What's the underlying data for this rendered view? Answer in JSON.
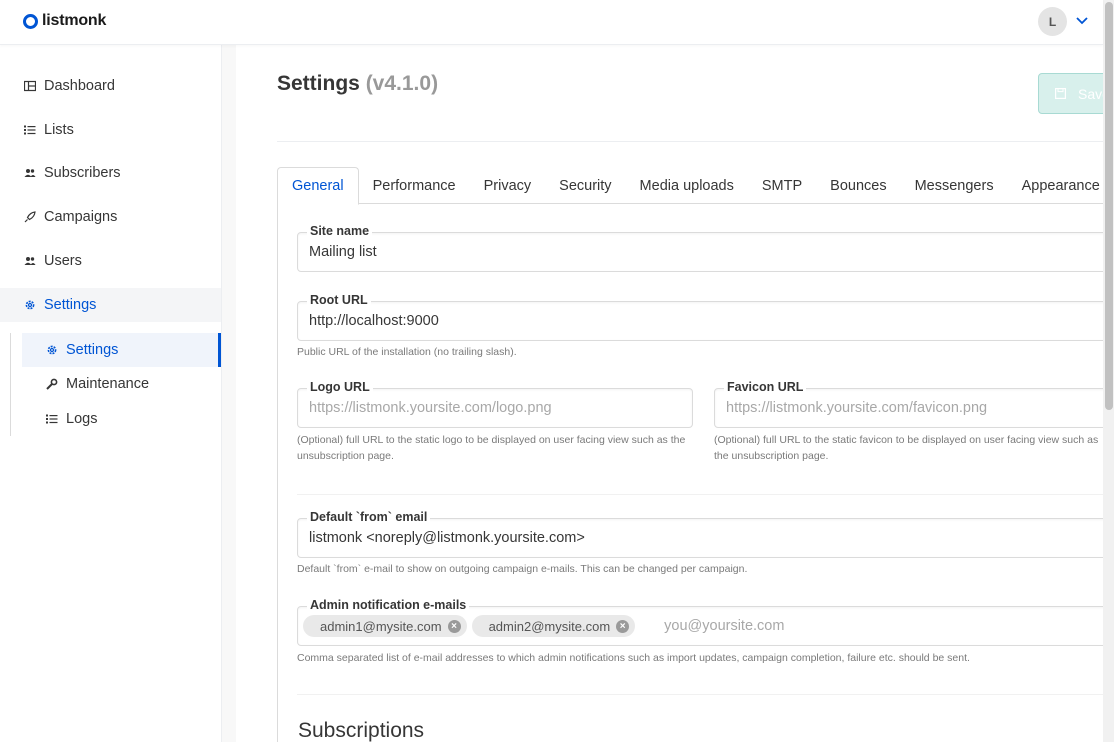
{
  "app": {
    "logo_text": "listmonk",
    "brand_color": "#0055d4"
  },
  "header": {
    "avatar_initial": "L"
  },
  "sidebar": {
    "items": [
      {
        "label": "Dashboard",
        "icon": "dashboard-icon"
      },
      {
        "label": "Lists",
        "icon": "list-icon"
      },
      {
        "label": "Subscribers",
        "icon": "users-icon"
      },
      {
        "label": "Campaigns",
        "icon": "rocket-icon"
      },
      {
        "label": "Users",
        "icon": "users-icon"
      },
      {
        "label": "Settings",
        "icon": "gear-icon"
      }
    ],
    "sub_items": [
      {
        "label": "Settings",
        "icon": "gear-icon"
      },
      {
        "label": "Maintenance",
        "icon": "wrench-icon"
      },
      {
        "label": "Logs",
        "icon": "list-icon"
      }
    ]
  },
  "page": {
    "title": "Settings",
    "version": "(v4.1.0)",
    "save_label": "Save"
  },
  "tabs": [
    "General",
    "Performance",
    "Privacy",
    "Security",
    "Media uploads",
    "SMTP",
    "Bounces",
    "Messengers",
    "Appearance"
  ],
  "form": {
    "site_name": {
      "label": "Site name",
      "value": "Mailing list"
    },
    "root_url": {
      "label": "Root URL",
      "value": "http://localhost:9000",
      "help": "Public URL of the installation (no trailing slash)."
    },
    "logo_url": {
      "label": "Logo URL",
      "placeholder": "https://listmonk.yoursite.com/logo.png",
      "help": "(Optional) full URL to the static logo to be displayed on user facing view such as the unsubscription page."
    },
    "favicon_url": {
      "label": "Favicon URL",
      "placeholder": "https://listmonk.yoursite.com/favicon.png",
      "help": "(Optional) full URL to the static favicon to be displayed on user facing view such as the unsubscription page."
    },
    "from_email": {
      "label": "Default `from` email",
      "value": "listmonk <noreply@listmonk.yoursite.com>",
      "help": "Default `from` e-mail to show on outgoing campaign e-mails. This can be changed per campaign."
    },
    "admin_emails": {
      "label": "Admin notification e-mails",
      "tags": [
        "admin1@mysite.com",
        "admin2@mysite.com"
      ],
      "placeholder": "you@yoursite.com",
      "help": "Comma separated list of e-mail addresses to which admin notifications such as import updates, campaign completion, failure etc. should be sent."
    }
  },
  "section": {
    "subscriptions_title": "Subscriptions"
  }
}
